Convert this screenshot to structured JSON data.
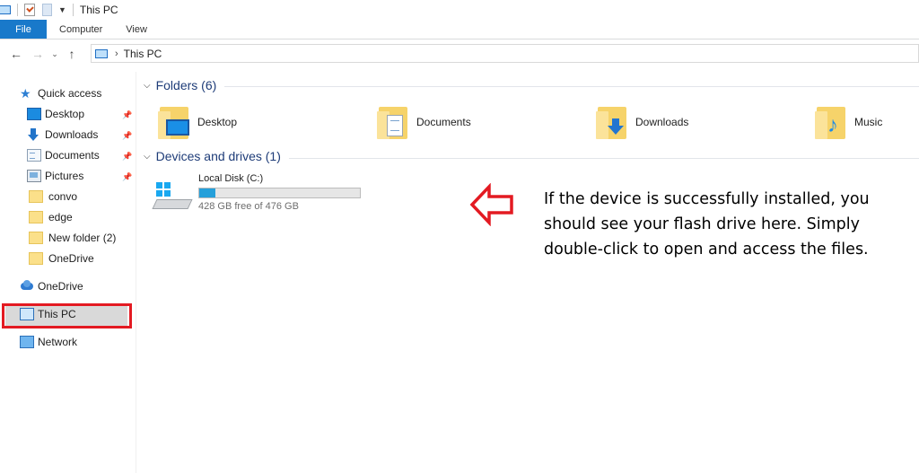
{
  "window": {
    "title": "This PC"
  },
  "ribbon": {
    "tabs": [
      "File",
      "Computer",
      "View"
    ]
  },
  "address": {
    "path": "This PC"
  },
  "sidebar": {
    "quick_access": "Quick access",
    "items": [
      {
        "label": "Desktop",
        "icon": "desktop-icon",
        "pinned": true
      },
      {
        "label": "Downloads",
        "icon": "downloads-icon",
        "pinned": true
      },
      {
        "label": "Documents",
        "icon": "documents-icon",
        "pinned": true
      },
      {
        "label": "Pictures",
        "icon": "pictures-icon",
        "pinned": true
      },
      {
        "label": "convo",
        "icon": "folder-icon",
        "pinned": false
      },
      {
        "label": "edge",
        "icon": "folder-icon",
        "pinned": false
      },
      {
        "label": "New folder (2)",
        "icon": "folder-icon",
        "pinned": false
      },
      {
        "label": "OneDrive",
        "icon": "folder-icon",
        "pinned": false
      }
    ],
    "onedrive": "OneDrive",
    "this_pc": "This PC",
    "network": "Network"
  },
  "folders_group": {
    "title": "Folders (6)",
    "items": [
      {
        "label": "Desktop",
        "icon": "desktop-folder-icon"
      },
      {
        "label": "Documents",
        "icon": "documents-folder-icon"
      },
      {
        "label": "Downloads",
        "icon": "downloads-folder-icon"
      },
      {
        "label": "Music",
        "icon": "music-folder-icon"
      }
    ]
  },
  "drives_group": {
    "title": "Devices and drives (1)",
    "drive": {
      "name": "Local Disk (C:)",
      "free_text": "428 GB free of 476 GB",
      "used_fraction": 0.1
    }
  },
  "annotation": {
    "text": "If the device is successfully installed, you should see your flash drive here. Simply double-click to open and access the files.",
    "color": "#e31a22"
  },
  "colors": {
    "accent": "#1979ca",
    "highlight": "#e31a22",
    "drive_fill": "#26a0da"
  }
}
